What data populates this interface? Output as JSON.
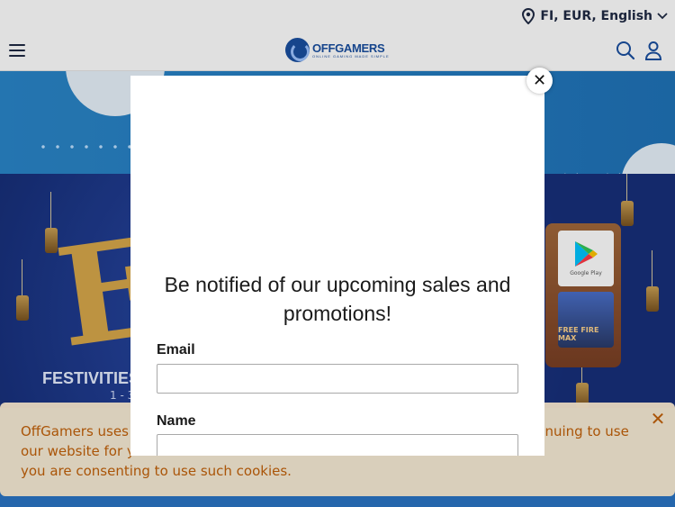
{
  "topbar": {
    "locale_label": "FI, EUR, English",
    "location_icon": "location-pin-icon",
    "chevron_icon": "chevron-down-icon"
  },
  "header": {
    "logo_text": "OFFGAMERS",
    "logo_tagline": "ONLINE GAMING MADE SIMPLE",
    "menu_icon": "hamburger-menu-icon",
    "search_icon": "search-icon",
    "account_icon": "user-icon"
  },
  "banner": {
    "headline_glyph": "E",
    "festivities_text": "FESTIVITIES",
    "date_text": "1 - 3",
    "store_tile_label": "Google Play",
    "game_tile_label": "FREE FIRE MAX"
  },
  "cookie_notice": {
    "line1": "OffGamers uses c",
    "line1_end": "ntinuing to use",
    "line2": "our website for y",
    "line3": "you are consenting to use such cookies.",
    "close_icon": "close-icon"
  },
  "modal": {
    "title_line1": "Be notified of our upcoming sales and",
    "title_line2": "promotions!",
    "email_label": "Email",
    "email_value": "",
    "name_label": "Name",
    "name_value": "",
    "close_symbol": "✕"
  },
  "colors": {
    "brand_blue": "#1a4fa0",
    "cookie_text": "#c2610a",
    "cookie_bg": "#ffefd6"
  }
}
